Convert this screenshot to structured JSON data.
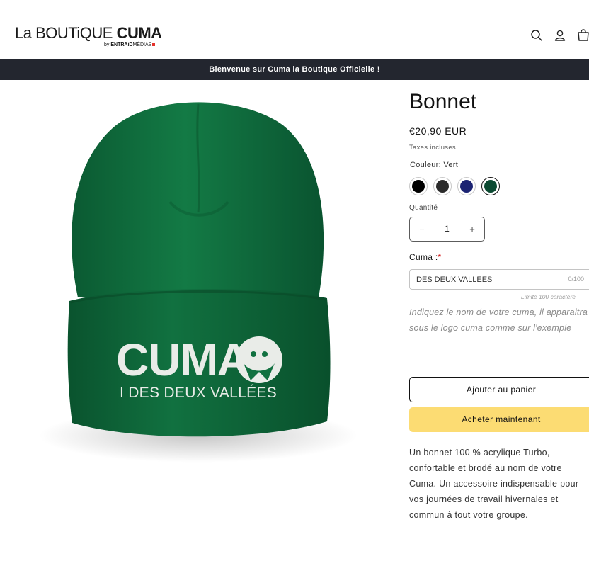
{
  "header": {
    "logo": {
      "part1": "La BOUTiQUE ",
      "part2": "CUMA",
      "sub_prefix": "by ",
      "sub_brand": "ENTRAiD",
      "sub_suffix": "MÉDIAS"
    },
    "icons": [
      "search-icon",
      "account-icon",
      "cart-icon"
    ]
  },
  "announcement": "Bienvenue sur Cuma la Boutique Officielle !",
  "product": {
    "image_text_main": "CUMA",
    "image_text_sub": "I DES DEUX VALLÉES",
    "title": "Bonnet",
    "price": "€20,90 EUR",
    "taxes": "Taxes incluses.",
    "color_label": "Couleur: Vert",
    "swatches": [
      {
        "name": "Noir",
        "color": "#000000",
        "selected": false
      },
      {
        "name": "Gris foncé",
        "color": "#2b2b2b",
        "selected": false
      },
      {
        "name": "Bleu marine",
        "color": "#1c2473",
        "selected": false
      },
      {
        "name": "Vert",
        "color": "#0c4a32",
        "selected": true
      }
    ],
    "quantity_label": "Quantité",
    "quantity": "1",
    "minus": "−",
    "plus": "+",
    "custom_field": {
      "label": "Cuma :",
      "required_mark": "*",
      "value": "DES DEUX VALLÉES",
      "counter": "0/100",
      "limit": "Limité 100 caractère"
    },
    "help_text": "Indiquez le nom de votre cuma, il apparaitra sous le logo cuma comme sur l'exemple",
    "add_to_cart": "Ajouter au panier",
    "buy_now": "Acheter maintenant",
    "description": "Un bonnet 100 % acrylique Turbo, confortable et brodé au nom de votre Cuma. Un accessoire indispensable pour vos journées de travail hivernales et commun à tout votre groupe."
  },
  "colors": {
    "accent_buy": "#fcdc73",
    "announce_bg": "#23262f",
    "beanie": "#0f6b3c"
  }
}
